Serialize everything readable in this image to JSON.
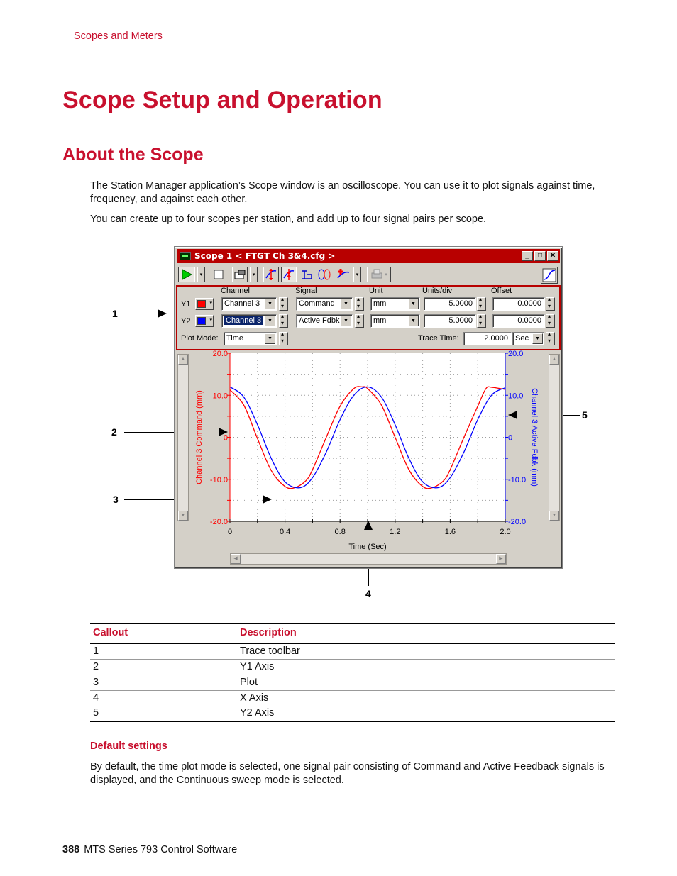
{
  "running_head": "Scopes and Meters",
  "heading1": "Scope Setup and Operation",
  "heading2": "About the Scope",
  "intro_paragraphs": [
    "The Station Manager application’s Scope window is an oscilloscope. You can use it to plot signals against time, frequency, and against each other.",
    "You can create up to four scopes per station, and add up to four signal pairs per scope."
  ],
  "figure": {
    "callouts": [
      "1",
      "2",
      "3",
      "4",
      "5"
    ],
    "scope_window": {
      "title": "Scope  1 < FTGT Ch 3&4.cfg >",
      "title_buttons": {
        "minimize": "_",
        "maximize": "□",
        "close": "✕"
      },
      "toolbar_icons": [
        "run-icon",
        "stop-icon",
        "properties-icon",
        "y1-scale-icon",
        "y2-scale-icon",
        "balance-icon",
        "lissajous-icon",
        "add-trace-icon",
        "print-icon",
        "chart-mode-icon"
      ],
      "trace_panel": {
        "headers": {
          "channel": "Channel",
          "signal": "Signal",
          "unit": "Unit",
          "units_div": "Units/div",
          "offset": "Offset"
        },
        "rows": [
          {
            "label": "Y1",
            "color": "#ff0000",
            "channel": "Channel 3",
            "signal": "Command",
            "unit": "mm",
            "units_div": "5.0000",
            "offset": "0.0000"
          },
          {
            "label": "Y2",
            "color": "#0000ff",
            "channel": "Channel 3",
            "signal": "Active Fdbk",
            "unit": "mm",
            "units_div": "5.0000",
            "offset": "0.0000"
          }
        ],
        "plot_mode_label": "Plot Mode:",
        "plot_mode": "Time",
        "trace_time_label": "Trace Time:",
        "trace_time": "2.0000",
        "trace_time_unit": "Sec"
      }
    }
  },
  "chart_data": {
    "type": "line",
    "title": "",
    "xlabel": "Time (Sec)",
    "ylabel": "Channel 3 Command (mm)",
    "y2label": "Channel 3 Active Fdbk (mm)",
    "xlim": [
      0,
      2.0
    ],
    "ylim": [
      -20,
      20
    ],
    "y2lim": [
      -20,
      20
    ],
    "x_ticks": [
      "0",
      "0.4",
      "0.8",
      "1.2",
      "1.6",
      "2.0"
    ],
    "y_ticks": [
      "20.0",
      "10.0",
      "0",
      "-10.0",
      "-20.0"
    ],
    "y2_ticks": [
      "20.0",
      "10.0",
      "0",
      "-10.0",
      "-20.0"
    ],
    "grid": true,
    "series": [
      {
        "name": "Channel 3 Command",
        "color": "#ff0000",
        "axis": "y1",
        "x": [
          0,
          0.1,
          0.2,
          0.3,
          0.4,
          0.47,
          0.55,
          0.6,
          0.7,
          0.8,
          0.9,
          0.96,
          1.0,
          1.1,
          1.2,
          1.3,
          1.4,
          1.47,
          1.55,
          1.6,
          1.7,
          1.8,
          1.86,
          1.9,
          2.0
        ],
        "y": [
          11.3,
          7.7,
          -0.3,
          -7.9,
          -11.7,
          -12.0,
          -10.4,
          -7.7,
          0.0,
          7.4,
          11.6,
          12.0,
          11.6,
          7.7,
          0.0,
          -7.7,
          -11.7,
          -12.0,
          -10.4,
          -7.7,
          0.0,
          7.4,
          11.6,
          11.9,
          11.4
        ]
      },
      {
        "name": "Channel 3 Active Fdbk",
        "color": "#0000ff",
        "axis": "y2",
        "x": [
          0,
          0.1,
          0.2,
          0.3,
          0.4,
          0.51,
          0.6,
          0.7,
          0.8,
          0.9,
          1.0,
          1.1,
          1.2,
          1.3,
          1.4,
          1.51,
          1.6,
          1.7,
          1.8,
          1.9,
          2.0
        ],
        "y": [
          12.0,
          9.6,
          3.0,
          -5.0,
          -10.6,
          -12.0,
          -9.6,
          -3.5,
          4.2,
          10.0,
          12.0,
          9.6,
          3.0,
          -5.0,
          -10.6,
          -12.0,
          -9.6,
          -3.5,
          4.2,
          10.0,
          11.8
        ]
      }
    ]
  },
  "callout_table": {
    "headers": [
      "Callout",
      "Description"
    ],
    "rows": [
      [
        "1",
        "Trace toolbar"
      ],
      [
        "2",
        "Y1 Axis"
      ],
      [
        "3",
        "Plot"
      ],
      [
        "4",
        "X Axis"
      ],
      [
        "5",
        "Y2 Axis"
      ]
    ]
  },
  "heading3": "Default settings",
  "default_paragraph": "By default, the time plot mode is selected, one signal pair consisting of Command and Active Feedback signals is displayed, and the Continuous sweep mode is selected.",
  "footer": {
    "page_number": "388",
    "book_title": "MTS Series 793 Control Software"
  }
}
